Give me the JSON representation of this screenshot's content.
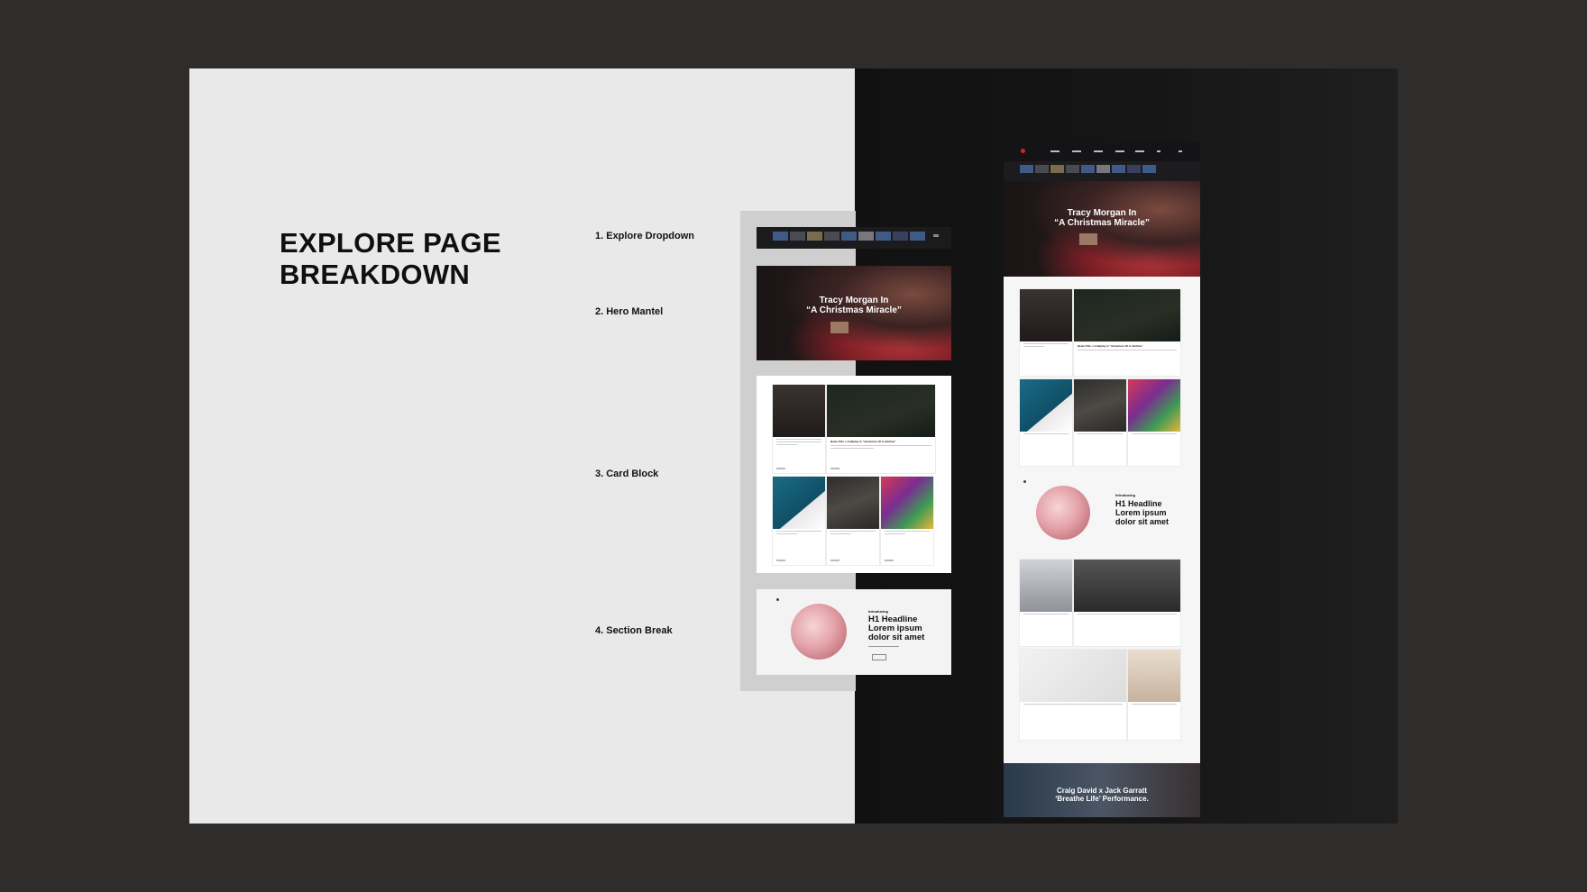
{
  "title": "EXPLORE PAGE\nBREAKDOWN",
  "steps": [
    {
      "label": "1. Explore Dropdown"
    },
    {
      "label": "2. Hero Mantel"
    },
    {
      "label": "3. Card Block"
    },
    {
      "label": "4. Section Break"
    }
  ],
  "hero": {
    "title": "Tracy Morgan In\n“A Christmas Miracle”"
  },
  "cards": {
    "row1": [
      {
        "caption": ""
      },
      {
        "caption": "Beats Pill+ x Coldplay in “Adventure Of A Lifetime”"
      }
    ],
    "row2": [
      {
        "caption": ""
      },
      {
        "caption": ""
      },
      {
        "caption": ""
      }
    ]
  },
  "section_break": {
    "eyebrow": "Introducing",
    "title": "H1 Headline\nLorem ipsum\ndolor sit amet"
  },
  "full_page": {
    "footer_title": "Craig David x Jack Garratt\n‘Breathe Life’ Performance."
  },
  "colors": {
    "board_bg": "#2f2c2c",
    "left_panel": "#e9e9ea",
    "right_panel": "#141414",
    "accent_red": "#d2232a"
  }
}
